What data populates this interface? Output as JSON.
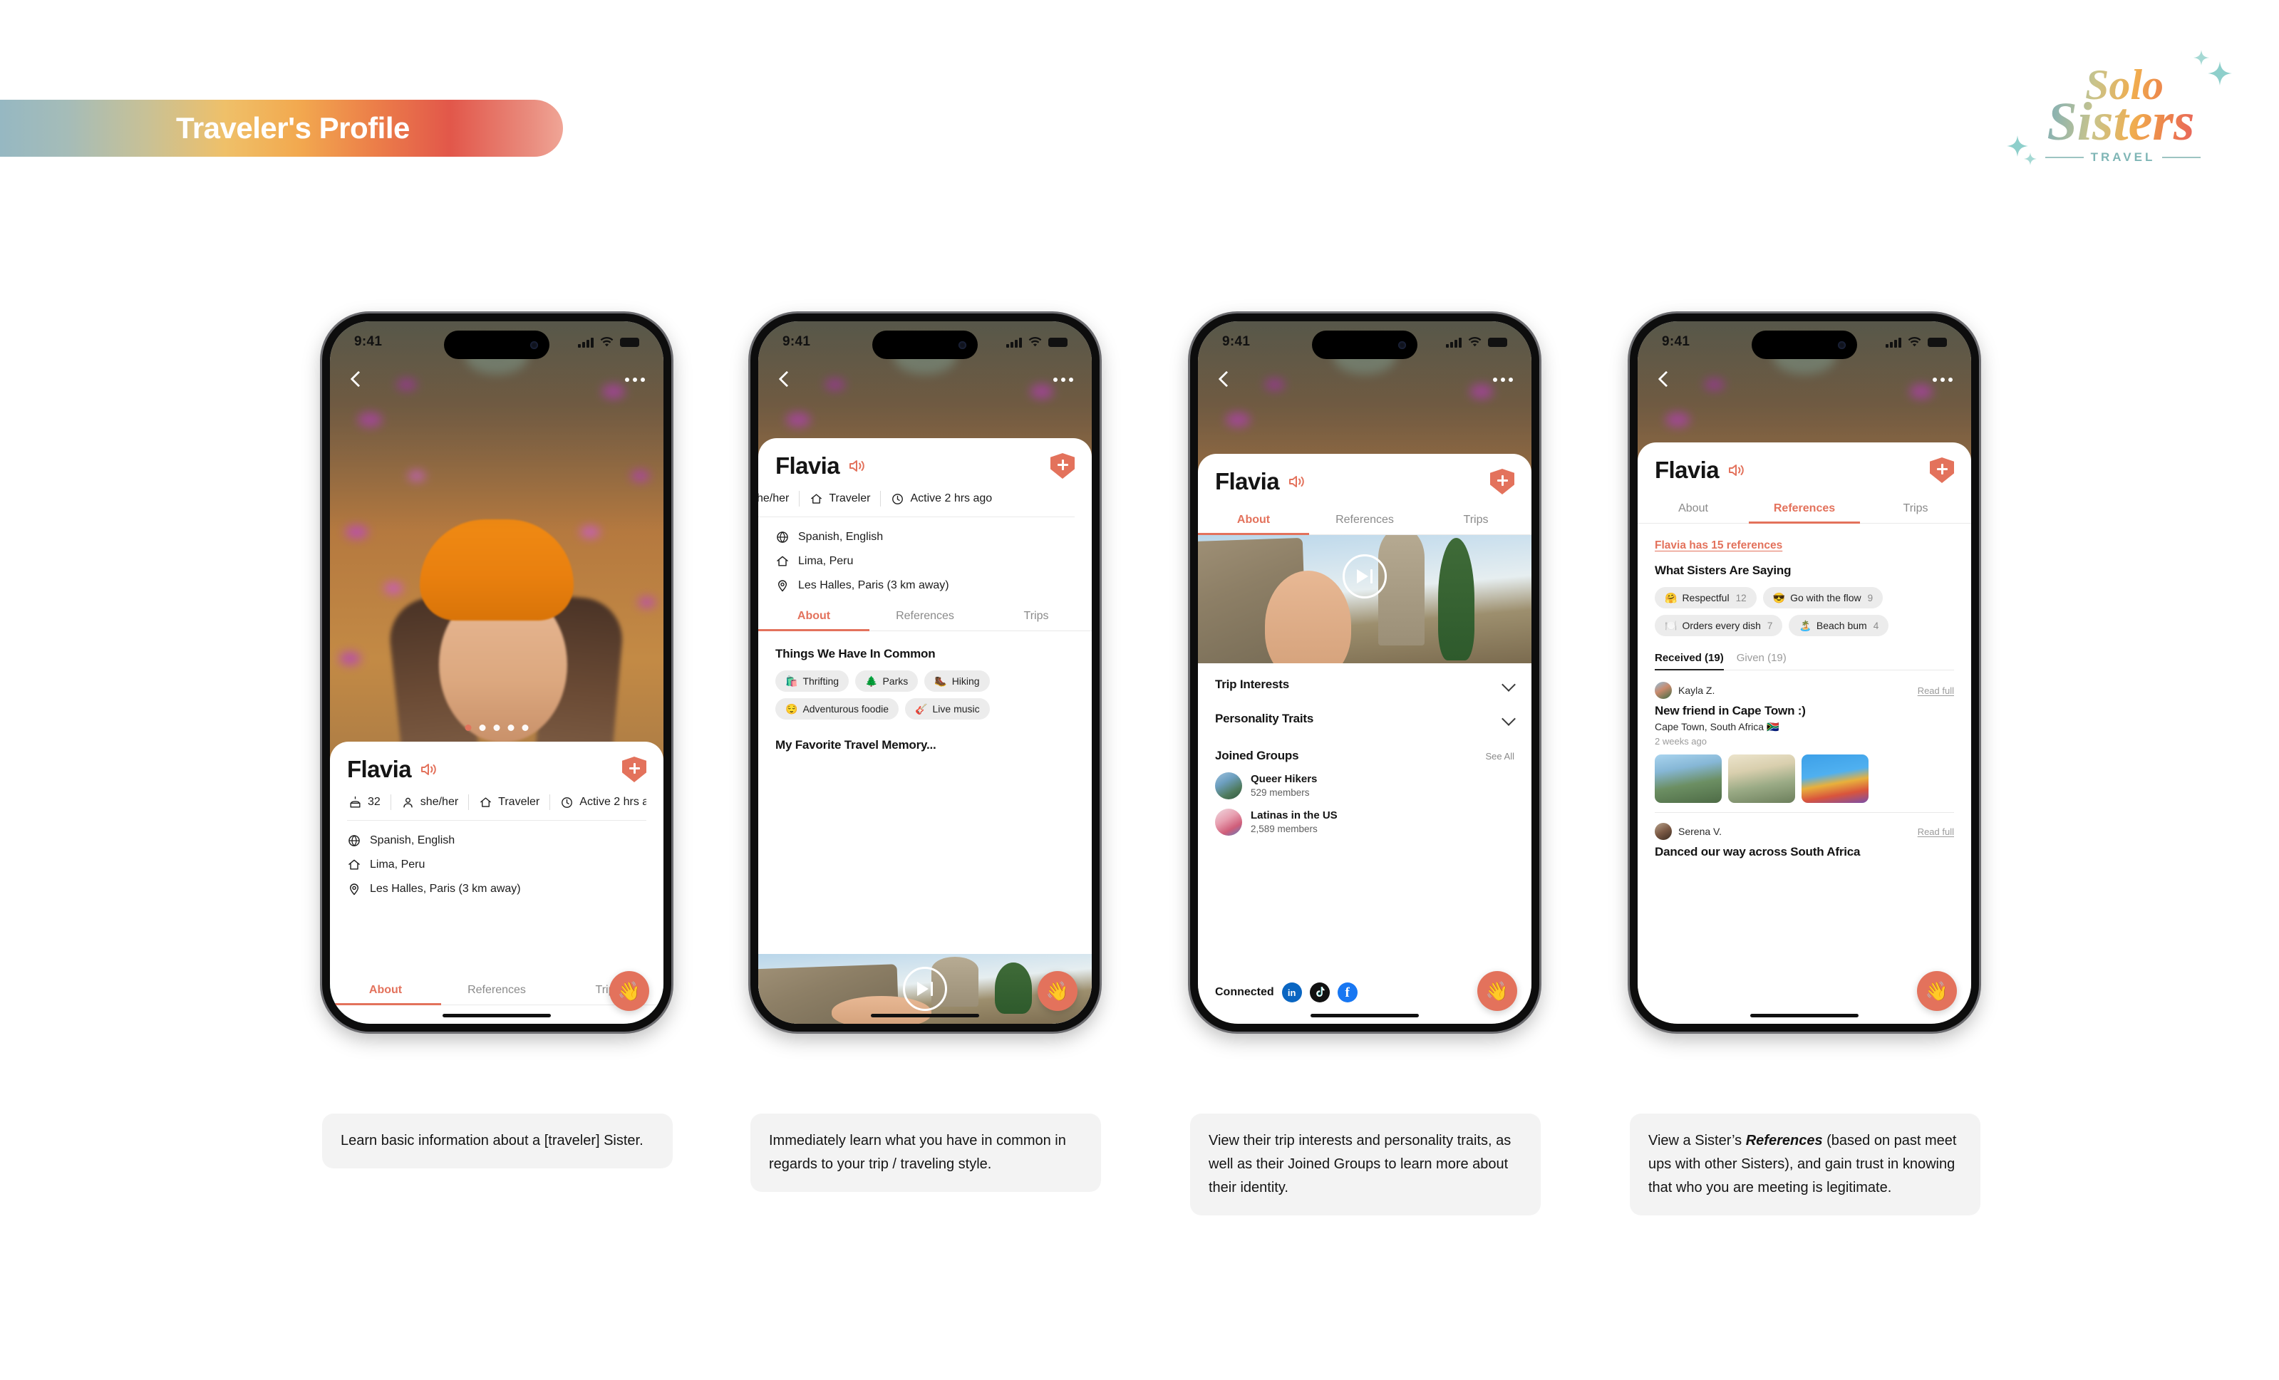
{
  "header": {
    "title": "Traveler's Profile",
    "gradient": [
      "#96b8c2",
      "#c8c196",
      "#efc069",
      "#ec8049",
      "#e2574a",
      "#f0a596"
    ]
  },
  "logo": {
    "line1": "Solo",
    "line2": "Sisters",
    "tagline": "TRAVEL"
  },
  "accent": "#e3725c",
  "status_bar": {
    "time": "9:41"
  },
  "profile": {
    "name": "Flavia",
    "age": "32",
    "pronouns": "she/her",
    "role": "Traveler",
    "active": "Active 2 hrs ago",
    "languages": "Spanish, English",
    "home": "Lima, Peru",
    "location": "Les Halles, Paris (3 km away)"
  },
  "tabs": {
    "about": "About",
    "references": "References",
    "trips": "Trips"
  },
  "phone1": {
    "active_tab": "About",
    "photo_dots": 5,
    "photo_dot_active": 0
  },
  "phone2": {
    "active_tab": "About",
    "common_title": "Things We Have In Common",
    "common_chips": [
      {
        "emoji": "🛍️",
        "label": "Thrifting"
      },
      {
        "emoji": "🌲",
        "label": "Parks"
      },
      {
        "emoji": "🥾",
        "label": "Hiking"
      },
      {
        "emoji": "😌",
        "label": "Adventurous foodie"
      },
      {
        "emoji": "🎸",
        "label": "Live music"
      }
    ],
    "memory_title": "My Favorite Travel Memory..."
  },
  "phone3": {
    "active_tab": "About",
    "trip_interests": "Trip Interests",
    "personality_traits": "Personality Traits",
    "joined_groups": "Joined Groups",
    "see_all": "See All",
    "groups": [
      {
        "name": "Queer Hikers",
        "members": "529 members"
      },
      {
        "name": "Latinas in the US",
        "members": "2,589 members"
      }
    ],
    "connected_label": "Connected",
    "social": [
      "linkedin-icon",
      "tiktok-icon",
      "facebook-icon"
    ]
  },
  "phone4": {
    "active_tab": "References",
    "ref_count_link": "Flavia has 15 references",
    "saying_title": "What Sisters Are Saying",
    "trait_chips": [
      {
        "emoji": "🤗",
        "label": "Respectful",
        "count": "12"
      },
      {
        "emoji": "😎",
        "label": "Go with the flow",
        "count": "9"
      },
      {
        "emoji": "🍽️",
        "label": "Orders every dish",
        "count": "7"
      },
      {
        "emoji": "🏝️",
        "label": "Beach bum",
        "count": "4"
      }
    ],
    "received_tab": "Received (19)",
    "given_tab": "Given (19)",
    "references": [
      {
        "author": "Kayla Z.",
        "read_full": "Read full",
        "title": "New friend in Cape Town :)",
        "location": "Cape Town, South Africa 🇿🇦",
        "time": "2 weeks ago"
      },
      {
        "author": "Serena V.",
        "read_full": "Read full",
        "title": "Danced our way across South Africa"
      }
    ]
  },
  "captions": {
    "c1": "Learn basic information about a [traveler] Sister.",
    "c2": "Immediately learn what you have in common in regards to your trip / traveling style.",
    "c3": "View their trip interests and personality traits, as well as their Joined Groups to learn more about their identity.",
    "c4_pre": "View a Sister’s ",
    "c4_em": "References",
    "c4_post": " (based on past meet ups with other Sisters), and gain trust in knowing that who you are meeting is legitimate."
  }
}
